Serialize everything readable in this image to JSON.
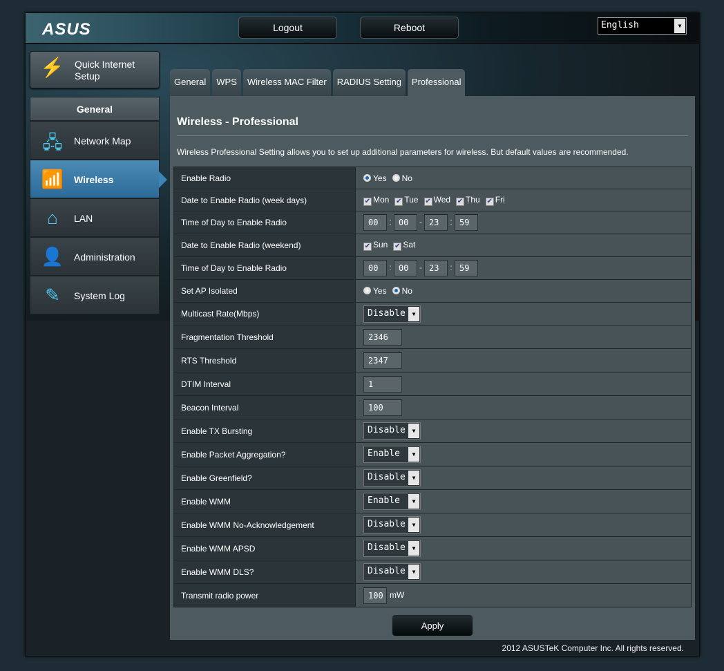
{
  "header": {
    "logo": "ASUS",
    "logout": "Logout",
    "reboot": "Reboot",
    "language": "English"
  },
  "sidebar": {
    "quick_setup": "Quick Internet Setup",
    "section": "General",
    "items": [
      {
        "label": "Network Map",
        "icon": "network-map-icon",
        "glyph": "🖧"
      },
      {
        "label": "Wireless",
        "icon": "wifi-icon",
        "glyph": "📶",
        "active": true
      },
      {
        "label": "LAN",
        "icon": "home-icon",
        "glyph": "⌂"
      },
      {
        "label": "Administration",
        "icon": "user-icon",
        "glyph": "👤"
      },
      {
        "label": "System Log",
        "icon": "log-edit-icon",
        "glyph": "✎"
      }
    ]
  },
  "tabs": [
    "General",
    "WPS",
    "Wireless MAC Filter",
    "RADIUS Setting",
    "Professional"
  ],
  "active_tab": "Professional",
  "page": {
    "title": "Wireless - Professional",
    "description": "Wireless Professional Setting allows you to set up additional parameters for wireless. But default values are recommended."
  },
  "rows": [
    {
      "label": "Enable Radio",
      "type": "radio",
      "options": [
        "Yes",
        "No"
      ],
      "selected": "Yes"
    },
    {
      "label": "Date to Enable Radio (week days)",
      "type": "check",
      "options": [
        "Mon",
        "Tue",
        "Wed",
        "Thu",
        "Fri"
      ]
    },
    {
      "label": "Time of Day to Enable Radio",
      "type": "time",
      "values": [
        "00",
        "00",
        "23",
        "59"
      ]
    },
    {
      "label": "Date to Enable Radio (weekend)",
      "type": "check",
      "options": [
        "Sun",
        "Sat"
      ]
    },
    {
      "label": "Time of Day to Enable Radio",
      "type": "time",
      "values": [
        "00",
        "00",
        "23",
        "59"
      ]
    },
    {
      "label": "Set AP Isolated",
      "type": "radio",
      "options": [
        "Yes",
        "No"
      ],
      "selected": "No"
    },
    {
      "label": "Multicast Rate(Mbps)",
      "type": "select",
      "value": "Disable"
    },
    {
      "label": "Fragmentation Threshold",
      "type": "text",
      "value": "2346"
    },
    {
      "label": "RTS Threshold",
      "type": "text",
      "value": "2347"
    },
    {
      "label": "DTIM Interval",
      "type": "text",
      "value": "1"
    },
    {
      "label": "Beacon Interval",
      "type": "text",
      "value": "100"
    },
    {
      "label": "Enable TX Bursting",
      "type": "select",
      "value": "Disable"
    },
    {
      "label": "Enable Packet Aggregation?",
      "type": "select",
      "value": "Enable"
    },
    {
      "label": "Enable Greenfield?",
      "type": "select",
      "value": "Disable"
    },
    {
      "label": "Enable WMM",
      "type": "select",
      "value": "Enable"
    },
    {
      "label": "Enable WMM No-Acknowledgement",
      "type": "select",
      "value": "Disable"
    },
    {
      "label": "Enable WMM APSD",
      "type": "select",
      "value": "Disable"
    },
    {
      "label": "Enable WMM DLS?",
      "type": "select",
      "value": "Disable"
    },
    {
      "label": "Transmit radio power",
      "type": "text_unit",
      "value": "100",
      "unit": "mW"
    }
  ],
  "apply": "Apply",
  "footer": "2012 ASUSTeK Computer Inc. All rights reserved."
}
